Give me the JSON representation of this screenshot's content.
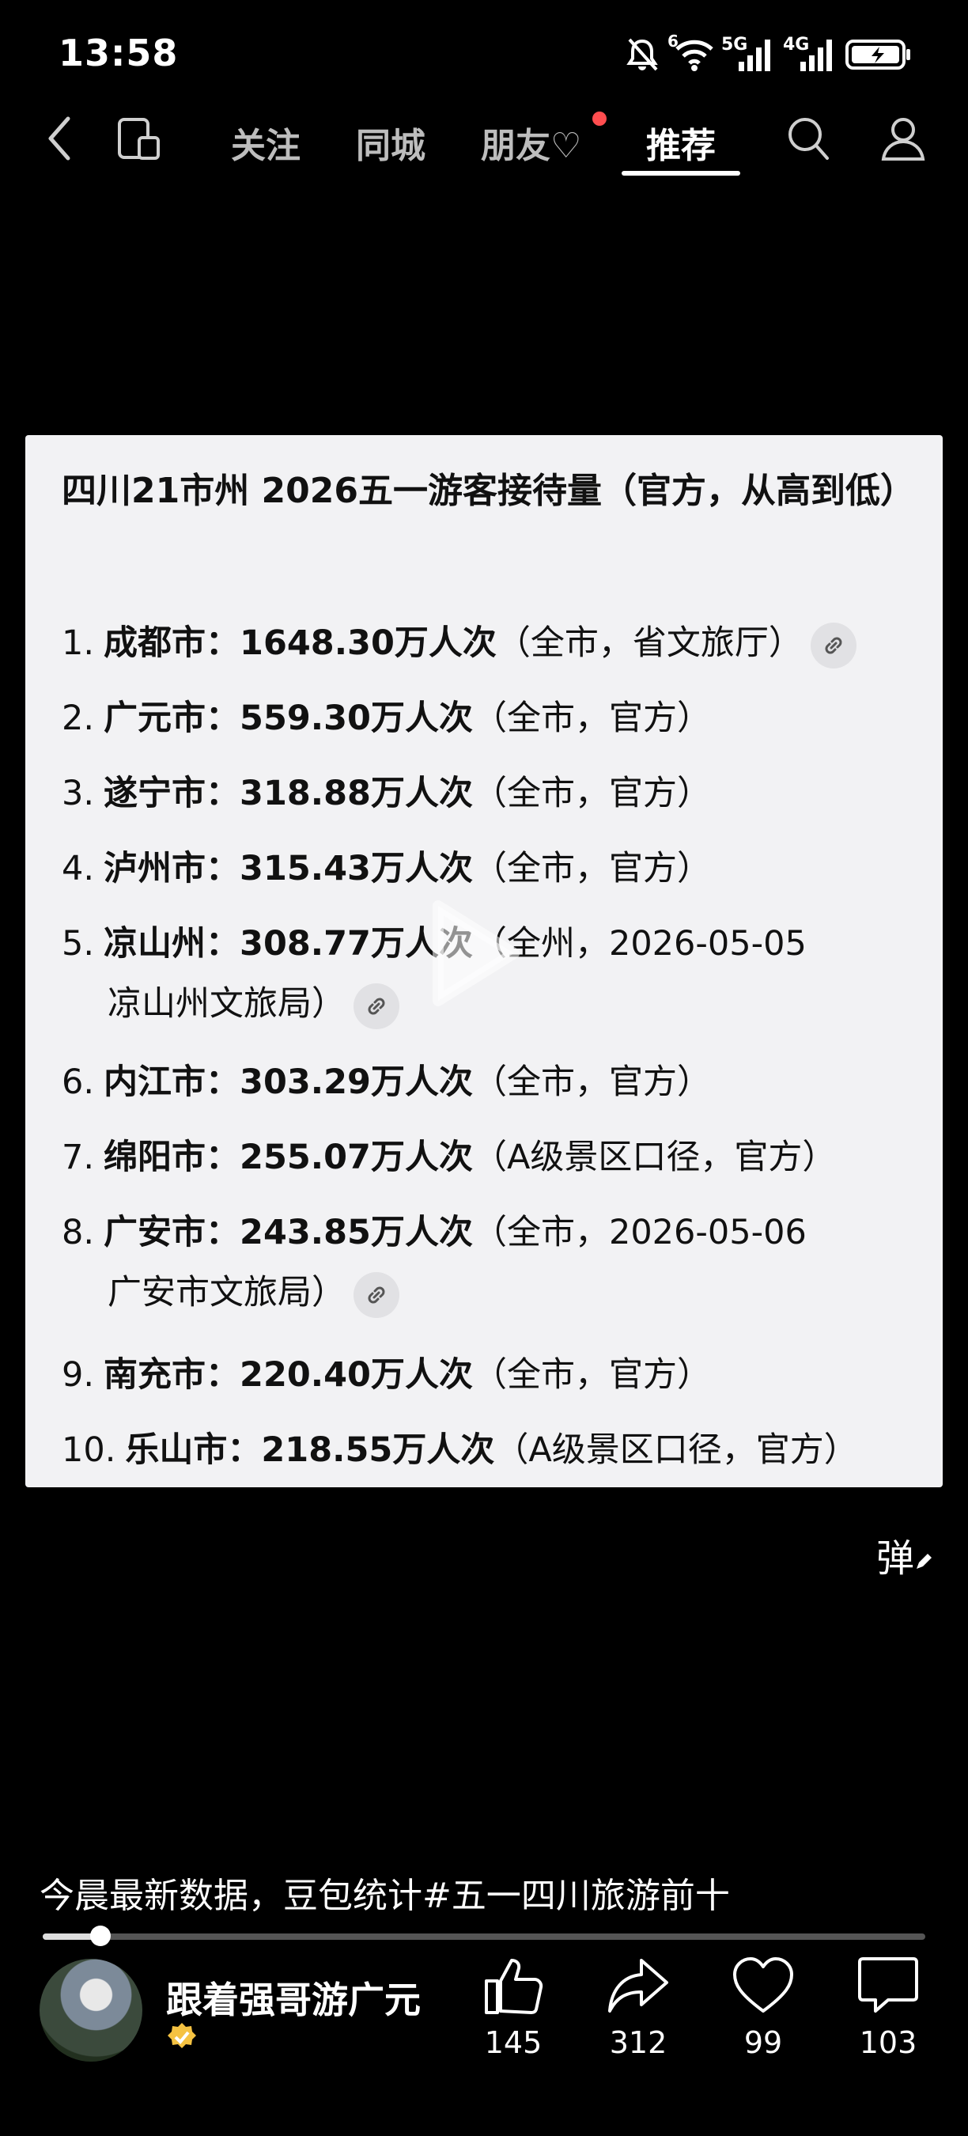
{
  "status_bar": {
    "time": "13:58",
    "net1": "5G",
    "net2": "4G",
    "sup": "6"
  },
  "nav": {
    "tabs": [
      "关注",
      "同城",
      "朋友♡",
      "推荐"
    ],
    "active": "推荐"
  },
  "card": {
    "title": "四川21市州 2026五一游客接待量（官方，从高到低）",
    "items": [
      {
        "rank": "1.",
        "name": "成都市：",
        "value": "1648.30万人次",
        "note": "（全市，省文旅厅）",
        "link": true
      },
      {
        "rank": "2.",
        "name": "广元市：",
        "value": "559.30万人次",
        "note": "（全市，官方）"
      },
      {
        "rank": "3.",
        "name": "遂宁市：",
        "value": "318.88万人次",
        "note": "（全市，官方）"
      },
      {
        "rank": "4.",
        "name": "泸州市：",
        "value": "315.43万人次",
        "note": "（全市，官方）"
      },
      {
        "rank": "5.",
        "name": "凉山州：",
        "value": "308.77万人次",
        "note": "（全州，2026-05-05",
        "note2": "凉山州文旅局）",
        "link": true
      },
      {
        "rank": "6.",
        "name": "内江市：",
        "value": "303.29万人次",
        "note": "（全市，官方）"
      },
      {
        "rank": "7.",
        "name": "绵阳市：",
        "value": "255.07万人次",
        "note": "（A级景区口径，官方）"
      },
      {
        "rank": "8.",
        "name": "广安市：",
        "value": "243.85万人次",
        "note": "（全市，2026-05-06",
        "note2": "广安市文旅局）",
        "link": true
      },
      {
        "rank": "9.",
        "name": "南充市：",
        "value": "220.40万人次",
        "note": "（全市，官方）"
      },
      {
        "rank": "10.",
        "name": "乐山市：",
        "value": "218.55万人次",
        "note": "（A级景区口径，官方）"
      }
    ]
  },
  "danmaku_label": "弹",
  "caption": "今晨最新数据，豆包统计#五一四川旅游前十",
  "progress": 0.065,
  "author": {
    "name": "跟着强哥游广元"
  },
  "actions": {
    "like": "145",
    "share": "312",
    "favorite": "99",
    "comment": "103"
  }
}
